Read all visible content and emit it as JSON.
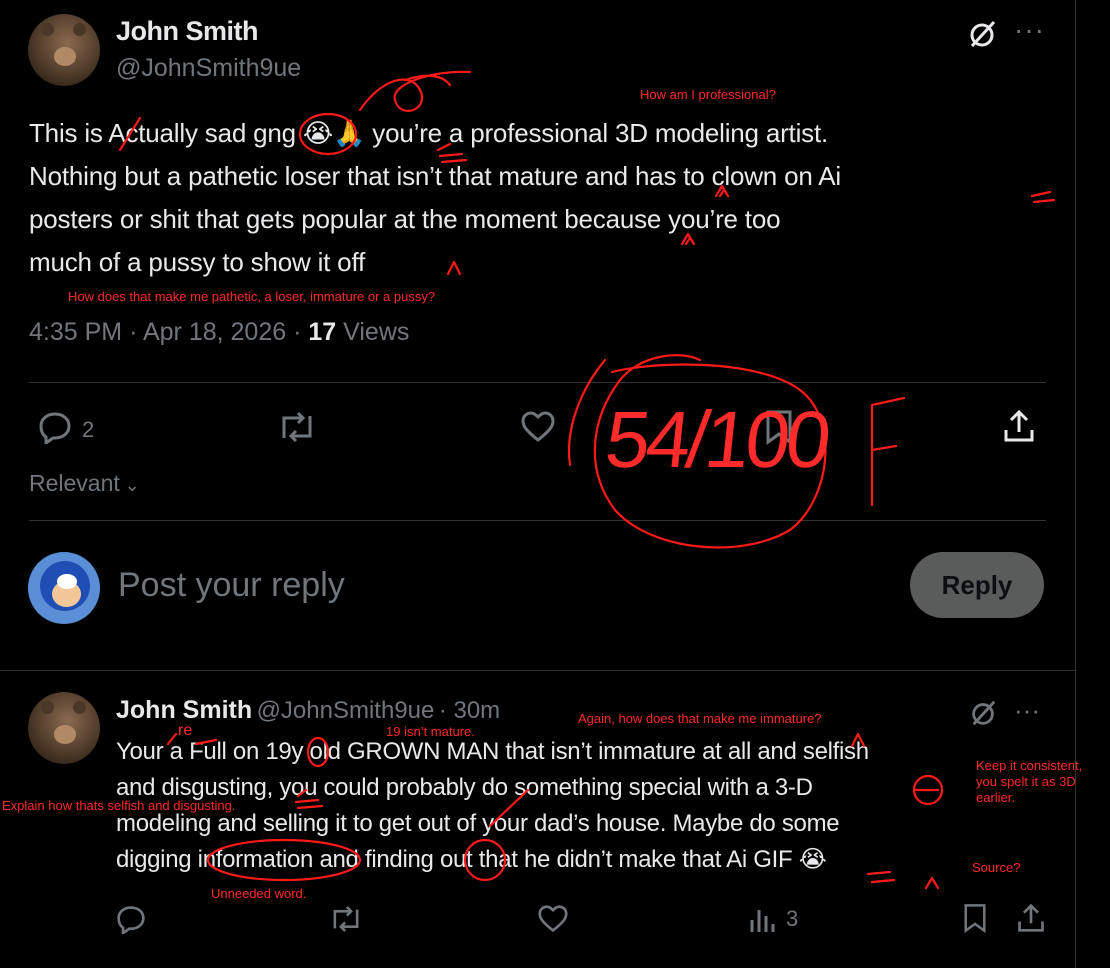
{
  "main_post": {
    "author_name": "John Smith",
    "handle": "@JohnSmith9ue",
    "text_lines": [
      "This is Actually sad gng 😭🙏 you’re a professional 3D modeling artist.",
      "Nothing but a pathetic loser that isn’t that mature and has to clown on Ai",
      "posters or shit that gets popular at the moment because you’re too",
      "much of a pussy to show it off"
    ],
    "time": "4:35 PM",
    "date": "Apr 18, 2026",
    "views_count": "17",
    "views_label": "Views",
    "reply_count": "2"
  },
  "sort": {
    "label": "Relevant"
  },
  "composer": {
    "placeholder": "Post your reply",
    "button_label": "Reply"
  },
  "reply_post": {
    "author_name": "John Smith",
    "handle": "@JohnSmith9ue",
    "time_ago": "30m",
    "text_lines": [
      "Your a Full on 19y old GROWN MAN that isn’t immature at all and selfish",
      "and disgusting, you could probably do something special with a 3-D",
      "modeling and selling it to get out of your dad’s house. Maybe do some",
      "digging information and finding out that he didn’t make that Ai GIF 😭"
    ],
    "views_count": "3"
  },
  "annotations": {
    "how_professional": "How am I professional?",
    "how_pathetic": "How does that make me pathetic, a loser, immature or a pussy?",
    "grade_score": "54/100",
    "grade_letter": "F",
    "again_immature": "Again, how does that make me immature?",
    "nineteen_not_mature": "19 isn’t mature.",
    "keep_consistent_1": "Keep it consistent,",
    "keep_consistent_2": "you spelt it as 3D",
    "keep_consistent_3": "earlier.",
    "explain_selfish": "Explain how thats selfish and disgusting.",
    "unneeded_word": "Unneeded word.",
    "source": "Source?",
    "you_re_fix": "re"
  },
  "colors": {
    "background": "#000000",
    "text": "#e7e9ea",
    "muted": "#71767b",
    "annotation_red": "#ff2a2a",
    "divider": "#2f3336"
  }
}
